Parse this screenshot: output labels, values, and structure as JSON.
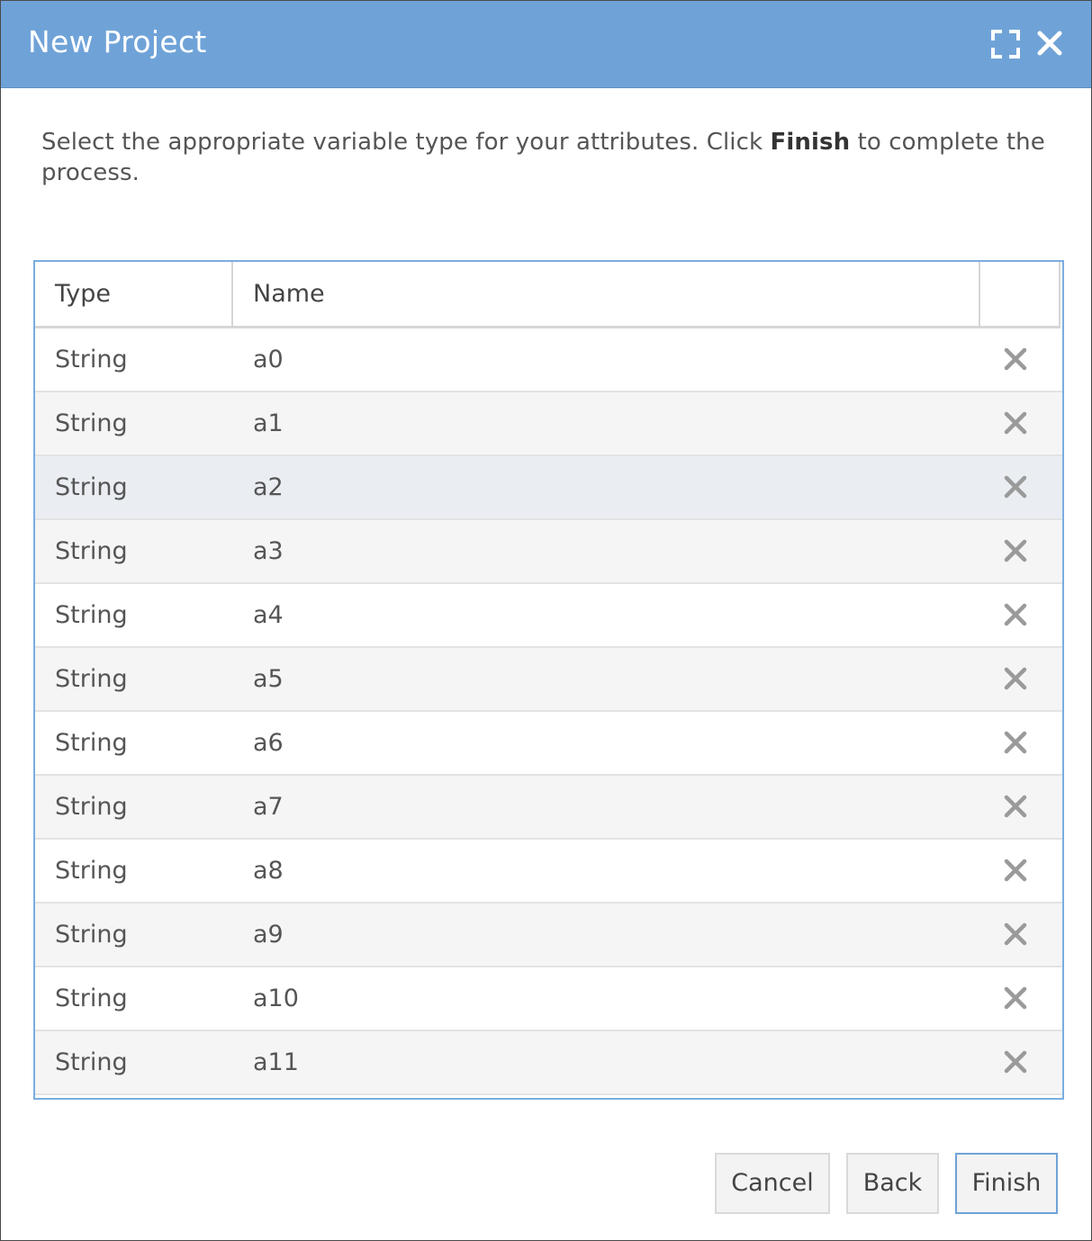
{
  "dialog": {
    "title": "New Project",
    "icons": {
      "maximize": "maximize-icon",
      "close": "close-icon"
    }
  },
  "instructions": {
    "before": "Select the appropriate variable type for your attributes. Click ",
    "bold": "Finish",
    "after": " to complete the process."
  },
  "table": {
    "headers": {
      "type": "Type",
      "name": "Name",
      "actions": ""
    },
    "rows": [
      {
        "type": "String",
        "name": "a0"
      },
      {
        "type": "String",
        "name": "a1"
      },
      {
        "type": "String",
        "name": "a2"
      },
      {
        "type": "String",
        "name": "a3"
      },
      {
        "type": "String",
        "name": "a4"
      },
      {
        "type": "String",
        "name": "a5"
      },
      {
        "type": "String",
        "name": "a6"
      },
      {
        "type": "String",
        "name": "a7"
      },
      {
        "type": "String",
        "name": "a8"
      },
      {
        "type": "String",
        "name": "a9"
      },
      {
        "type": "String",
        "name": "a10"
      },
      {
        "type": "String",
        "name": "a11"
      }
    ],
    "hovered_row": 2,
    "delete_icon": "remove-icon"
  },
  "footer": {
    "cancel_label": "Cancel",
    "back_label": "Back",
    "finish_label": "Finish"
  },
  "colors": {
    "titlebar": "#6fa3d8",
    "grid_border": "#7aaee2",
    "row_alt": "#f5f5f5",
    "row_hover": "#eaeef3"
  }
}
